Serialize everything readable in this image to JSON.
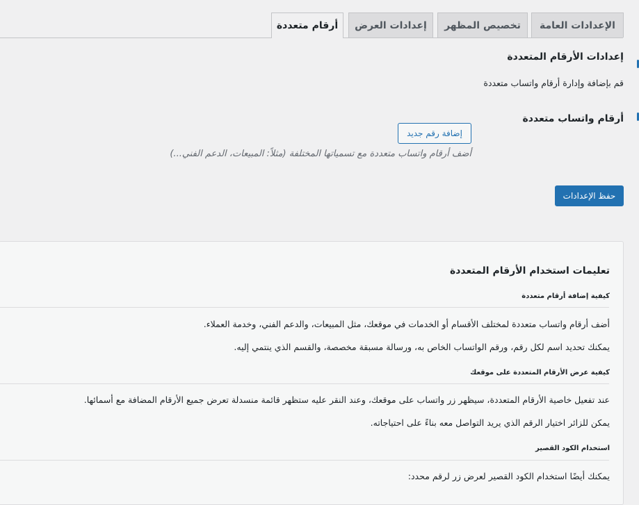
{
  "tabs": [
    {
      "label": "الإعدادات العامة"
    },
    {
      "label": "تخصيص المظهر"
    },
    {
      "label": "إعدادات العرض"
    },
    {
      "label": "أرقام متعددة"
    }
  ],
  "settings": {
    "title": "إعدادات الأرقام المتعددة",
    "intro": "قم بإضافة وإدارة أرقام واتساب متعددة",
    "field_label": "أرقام واتساب متعددة",
    "add_button": "إضافة رقم جديد",
    "field_description": "أضف أرقام واتساب متعددة مع تسمياتها المختلفة (مثلاً: المبيعات، الدعم الفني...)",
    "save_button": "حفظ الإعدادات"
  },
  "instructions": {
    "title": "تعليمات استخدام الأرقام المتعددة",
    "sections": [
      {
        "heading": "كيفية إضافة أرقام متعددة",
        "paragraphs": [
          "أضف أرقام واتساب متعددة لمختلف الأقسام أو الخدمات في موقعك، مثل المبيعات، والدعم الفني، وخدمة العملاء.",
          "يمكنك تحديد اسم لكل رقم، ورقم الواتساب الخاص به، ورسالة مسبقة مخصصة، والقسم الذي ينتمي إليه."
        ]
      },
      {
        "heading": "كيفية عرض الأرقام المتعددة على موقعك",
        "paragraphs": [
          "عند تفعيل خاصية الأرقام المتعددة، سيظهر زر واتساب على موقعك، وعند النقر عليه ستظهر قائمة منسدلة تعرض جميع الأرقام المضافة مع أسمائها.",
          "يمكن للزائر اختيار الرقم الذي يريد التواصل معه بناءً على احتياجاته."
        ]
      },
      {
        "heading": "استخدام الكود القصير",
        "paragraphs": [
          "يمكنك أيضًا استخدام الكود القصير لعرض زر لرقم محدد:"
        ]
      }
    ]
  },
  "colors": {
    "accent": "#2271b1",
    "page_background": "#f0f0f1",
    "card_background": "#f6f7f7"
  }
}
